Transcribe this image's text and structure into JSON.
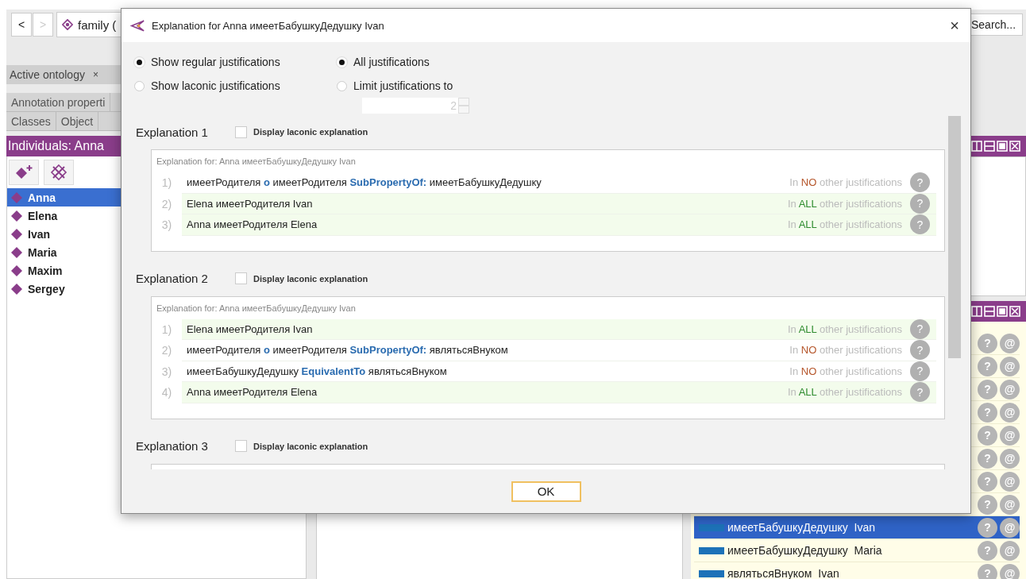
{
  "app": {
    "nav": [
      {
        "label": "<",
        "disabled": false
      },
      {
        "label": ">",
        "disabled": true
      }
    ],
    "ontology_label": "family (",
    "search": {
      "placeholder": "Search..."
    },
    "ontology_tab": {
      "label": "Active ontology",
      "close": "×"
    },
    "tabs_row1": [
      {
        "label": "Annotation properti",
        "selected": false
      }
    ],
    "tabs_row2": [
      {
        "label": "Classes",
        "selected": false
      },
      {
        "label": "Object",
        "selected": false
      }
    ],
    "individuals": {
      "title": "Individuals: Anna",
      "items": [
        {
          "label": "Anna",
          "selected": true
        },
        {
          "label": "Elena",
          "selected": false
        },
        {
          "label": "Ivan",
          "selected": false
        },
        {
          "label": "Maria",
          "selected": false
        },
        {
          "label": "Maxim",
          "selected": false
        },
        {
          "label": "Sergey",
          "selected": false
        }
      ]
    },
    "assertions": [
      {
        "selected": false,
        "actions": [
          "?",
          "@"
        ]
      },
      {
        "selected": false,
        "actions": [
          "?",
          "@"
        ]
      },
      {
        "selected": false,
        "actions": [
          "?",
          "@"
        ]
      },
      {
        "selected": false,
        "actions": [
          "?",
          "@"
        ]
      },
      {
        "selected": false,
        "actions": [
          "?",
          "@"
        ]
      },
      {
        "selected": false,
        "actions": [
          "?",
          "@"
        ]
      },
      {
        "selected": false,
        "actions": [
          "?",
          "@"
        ]
      },
      {
        "selected": false,
        "actions": [
          "?",
          "@"
        ]
      },
      {
        "property": "имеетБабушкуДедушку",
        "value": "Ivan",
        "selected": true,
        "actions": [
          "?",
          "@"
        ]
      },
      {
        "property": "имеетБабушкуДедушку",
        "value": "Maria",
        "selected": false,
        "actions": [
          "?",
          "@"
        ]
      },
      {
        "property": "являтьсяВнуком",
        "value": "Ivan",
        "selected": false,
        "actions": [
          "?",
          "@"
        ]
      }
    ]
  },
  "dialog": {
    "title": "Explanation for Anna имеетБабушкуДедушку Ivan",
    "close": "×",
    "mode_options": [
      {
        "label": "Show regular justifications",
        "selected": true
      },
      {
        "label": "Show laconic justifications",
        "selected": false
      }
    ],
    "limit_options": [
      {
        "label": "All justifications",
        "selected": true
      },
      {
        "label": "Limit justifications to",
        "selected": false
      }
    ],
    "limit_field": {
      "value": "2",
      "disabled": true
    },
    "explanations": [
      {
        "title": "Explanation 1",
        "laconic_label": "Display laconic explanation",
        "checked": false,
        "caption": "Explanation for: Anna имеетБабушкуДедушку Ivan",
        "rows": [
          {
            "number": "1)",
            "parts": [
              {
                "kind": "entity",
                "text": "имеетРодителя"
              },
              {
                "kind": "keyword",
                "text": "o"
              },
              {
                "kind": "entity",
                "text": "имеетРодителя"
              },
              {
                "kind": "keyword",
                "text": "SubPropertyOf:"
              },
              {
                "kind": "entity",
                "text": "имеетБабушкуДедушку"
              }
            ],
            "in_all": false,
            "usage_parts": [
              "In",
              "NO",
              "other justifications"
            ],
            "help": "?"
          },
          {
            "number": "2)",
            "parts": [
              {
                "kind": "entity",
                "text": "Elena"
              },
              {
                "kind": "entity",
                "text": "имеетРодителя"
              },
              {
                "kind": "entity",
                "text": "Ivan"
              }
            ],
            "in_all": true,
            "usage_parts": [
              "In",
              "ALL",
              "other justifications"
            ],
            "help": "?"
          },
          {
            "number": "3)",
            "parts": [
              {
                "kind": "entity",
                "text": "Anna"
              },
              {
                "kind": "entity",
                "text": "имеетРодителя"
              },
              {
                "kind": "entity",
                "text": "Elena"
              }
            ],
            "in_all": true,
            "usage_parts": [
              "In",
              "ALL",
              "other justifications"
            ],
            "help": "?"
          }
        ]
      },
      {
        "title": "Explanation 2",
        "laconic_label": "Display laconic explanation",
        "checked": false,
        "caption": "Explanation for: Anna имеетБабушкуДедушку Ivan",
        "rows": [
          {
            "number": "1)",
            "parts": [
              {
                "kind": "entity",
                "text": "Elena"
              },
              {
                "kind": "entity",
                "text": "имеетРодителя"
              },
              {
                "kind": "entity",
                "text": "Ivan"
              }
            ],
            "in_all": true,
            "usage_parts": [
              "In",
              "ALL",
              "other justifications"
            ],
            "help": "?"
          },
          {
            "number": "2)",
            "parts": [
              {
                "kind": "entity",
                "text": "имеетРодителя"
              },
              {
                "kind": "keyword",
                "text": "o"
              },
              {
                "kind": "entity",
                "text": "имеетРодителя"
              },
              {
                "kind": "keyword",
                "text": "SubPropertyOf:"
              },
              {
                "kind": "entity",
                "text": "являтьсяВнуком"
              }
            ],
            "in_all": false,
            "usage_parts": [
              "In",
              "NO",
              "other justifications"
            ],
            "help": "?"
          },
          {
            "number": "3)",
            "parts": [
              {
                "kind": "entity",
                "text": "имеетБабушкуДедушку"
              },
              {
                "kind": "keyword",
                "text": "EquivalentTo"
              },
              {
                "kind": "entity",
                "text": "являтьсяВнуком"
              }
            ],
            "in_all": false,
            "usage_parts": [
              "In",
              "NO",
              "other justifications"
            ],
            "help": "?"
          },
          {
            "number": "4)",
            "parts": [
              {
                "kind": "entity",
                "text": "Anna"
              },
              {
                "kind": "entity",
                "text": "имеетРодителя"
              },
              {
                "kind": "entity",
                "text": "Elena"
              }
            ],
            "in_all": true,
            "usage_parts": [
              "In",
              "ALL",
              "other justifications"
            ],
            "help": "?"
          }
        ]
      },
      {
        "title": "Explanation 3",
        "laconic_label": "Display laconic explanation",
        "checked": false
      }
    ],
    "ok": "OK"
  }
}
